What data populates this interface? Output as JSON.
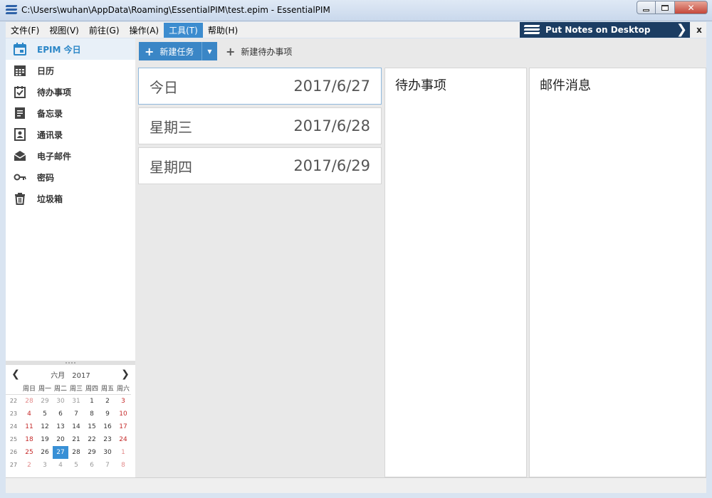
{
  "window": {
    "title": "C:\\Users\\wuhan\\AppData\\Roaming\\EssentialPIM\\test.epim - EssentialPIM",
    "close_glyph": "✕"
  },
  "menu": {
    "items": [
      "文件(F)",
      "视图(V)",
      "前往(G)",
      "操作(A)",
      "工具(T)",
      "帮助(H)"
    ],
    "active_index": 4,
    "notes_button": "Put Notes on Desktop",
    "notes_arrow": "❯",
    "close_glyph": "x"
  },
  "sidebar": {
    "items": [
      {
        "label": "EPIM 今日",
        "icon": "calendar-today-icon"
      },
      {
        "label": "日历",
        "icon": "calendar-grid-icon"
      },
      {
        "label": "待办事项",
        "icon": "checkbox-icon"
      },
      {
        "label": "备忘录",
        "icon": "notes-icon"
      },
      {
        "label": "通讯录",
        "icon": "contact-icon"
      },
      {
        "label": "电子邮件",
        "icon": "envelope-icon"
      },
      {
        "label": "密码",
        "icon": "key-icon"
      },
      {
        "label": "垃圾箱",
        "icon": "trash-icon"
      }
    ],
    "active_index": 0
  },
  "minical": {
    "month": "六月",
    "year": "2017",
    "prev": "❮",
    "next": "❯",
    "weekdays": [
      "周日",
      "周一",
      "周二",
      "周三",
      "周四",
      "周五",
      "周六"
    ],
    "weeks": [
      {
        "num": "22",
        "days": [
          "28",
          "29",
          "30",
          "31",
          "1",
          "2",
          "3"
        ]
      },
      {
        "num": "23",
        "days": [
          "4",
          "5",
          "6",
          "7",
          "8",
          "9",
          "10"
        ]
      },
      {
        "num": "24",
        "days": [
          "11",
          "12",
          "13",
          "14",
          "15",
          "16",
          "17"
        ]
      },
      {
        "num": "25",
        "days": [
          "18",
          "19",
          "20",
          "21",
          "22",
          "23",
          "24"
        ]
      },
      {
        "num": "26",
        "days": [
          "25",
          "26",
          "27",
          "28",
          "29",
          "30",
          "1"
        ]
      },
      {
        "num": "27",
        "days": [
          "2",
          "3",
          "4",
          "5",
          "6",
          "7",
          "8"
        ]
      }
    ],
    "today": "27"
  },
  "toolbar": {
    "new_task": "新建任务",
    "new_todo": "新建待办事项",
    "plus": "+",
    "dropdown": "▼"
  },
  "days": [
    {
      "name": "今日",
      "date": "2017/6/27"
    },
    {
      "name": "星期三",
      "date": "2017/6/28"
    },
    {
      "name": "星期四",
      "date": "2017/6/29"
    }
  ],
  "panels": {
    "todo_title": "待办事项",
    "mail_title": "邮件消息"
  },
  "colors": {
    "accent": "#3a86c6",
    "notes_bar": "#1c3d63",
    "weekend": "#c52a2a",
    "today_bg": "#3890d6"
  }
}
